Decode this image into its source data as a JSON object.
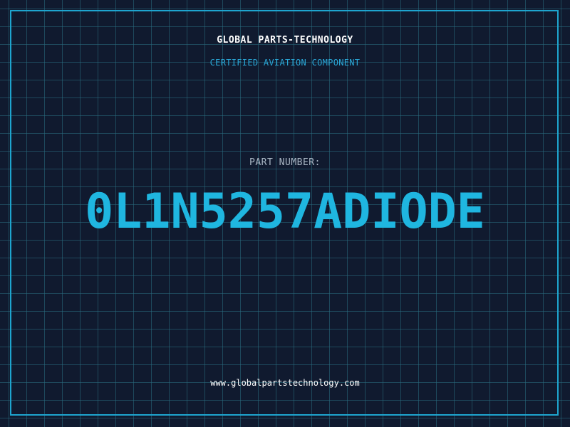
{
  "header": {
    "company": "GLOBAL PARTS-TECHNOLOGY",
    "subtitle": "CERTIFIED AVIATION COMPONENT"
  },
  "part": {
    "label": "PART NUMBER:",
    "number": "0L1N5257ADIODE"
  },
  "footer": {
    "website": "www.globalpartstechnology.com"
  },
  "colors": {
    "background": "#101a2f",
    "grid": "#2a6e82",
    "accent": "#1fb6e0",
    "text": "#ffffff",
    "label": "#a9b6c4"
  }
}
